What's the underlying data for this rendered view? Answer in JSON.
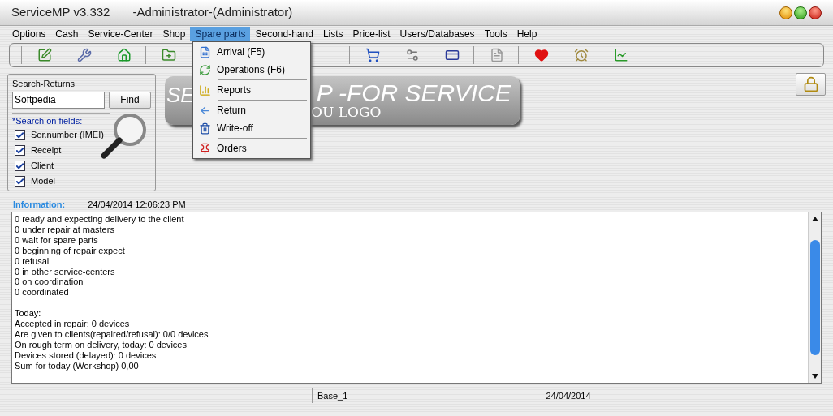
{
  "window": {
    "title": "ServiceMP v3.332",
    "user": "-Administrator-(Administrator)"
  },
  "menu": [
    {
      "label": "Options",
      "selected": false
    },
    {
      "label": "Cash",
      "selected": false
    },
    {
      "label": "Service-Center",
      "selected": false
    },
    {
      "label": "Shop",
      "selected": false
    },
    {
      "label": "Spare parts",
      "selected": true
    },
    {
      "label": "Second-hand",
      "selected": false
    },
    {
      "label": "Lists",
      "selected": false
    },
    {
      "label": "Price-list",
      "selected": false
    },
    {
      "label": "Users/Databases",
      "selected": false
    },
    {
      "label": "Tools",
      "selected": false
    },
    {
      "label": "Help",
      "selected": false
    }
  ],
  "dropdown": [
    {
      "label": "Arrival (F5)",
      "kind": "arrival",
      "separator_after": false
    },
    {
      "label": "Operations (F6)",
      "kind": "operations",
      "separator_after": true
    },
    {
      "label": "Reports",
      "kind": "reports",
      "separator_after": true
    },
    {
      "label": "Return",
      "kind": "return",
      "separator_after": false
    },
    {
      "label": "Write-off",
      "kind": "writeoff",
      "separator_after": true
    },
    {
      "label": "Orders",
      "kind": "orders",
      "separator_after": false
    }
  ],
  "search": {
    "title": "Search-Returns",
    "value": "Softpedia",
    "button": "Find",
    "fields_label": "*Search on fields:",
    "fields": [
      {
        "label": "Ser.number (IMEI)",
        "checked": true
      },
      {
        "label": "Receipt",
        "checked": true
      },
      {
        "label": "Client",
        "checked": true
      },
      {
        "label": "Model",
        "checked": true
      }
    ]
  },
  "logo": {
    "line1_left": "SE",
    "line1_right": "P -FOR SERVICE",
    "line2_right": "OU LOGO"
  },
  "info": {
    "label": "Information:",
    "timestamp": "24/04/2014 12:06:23 PM",
    "lines": [
      "0 ready and expecting delivery to the client",
      "0 under repair at masters",
      "0 wait for spare parts",
      "0 beginning of repair expect",
      "0 refusal",
      "0 in other service-centers",
      "0 on coordination",
      "0 coordinated"
    ],
    "today_lines": [
      "Today:",
      "Accepted in repair: 0 devices",
      "Are given to clients(repaired/refusal): 0/0 devices",
      "On rough term on delivery, today: 0 devices",
      "Devices stored (delayed): 0 devices",
      "Sum for today (Workshop) 0,00"
    ]
  },
  "status_bar": {
    "database": "Base_1",
    "date": "24/04/2014"
  }
}
